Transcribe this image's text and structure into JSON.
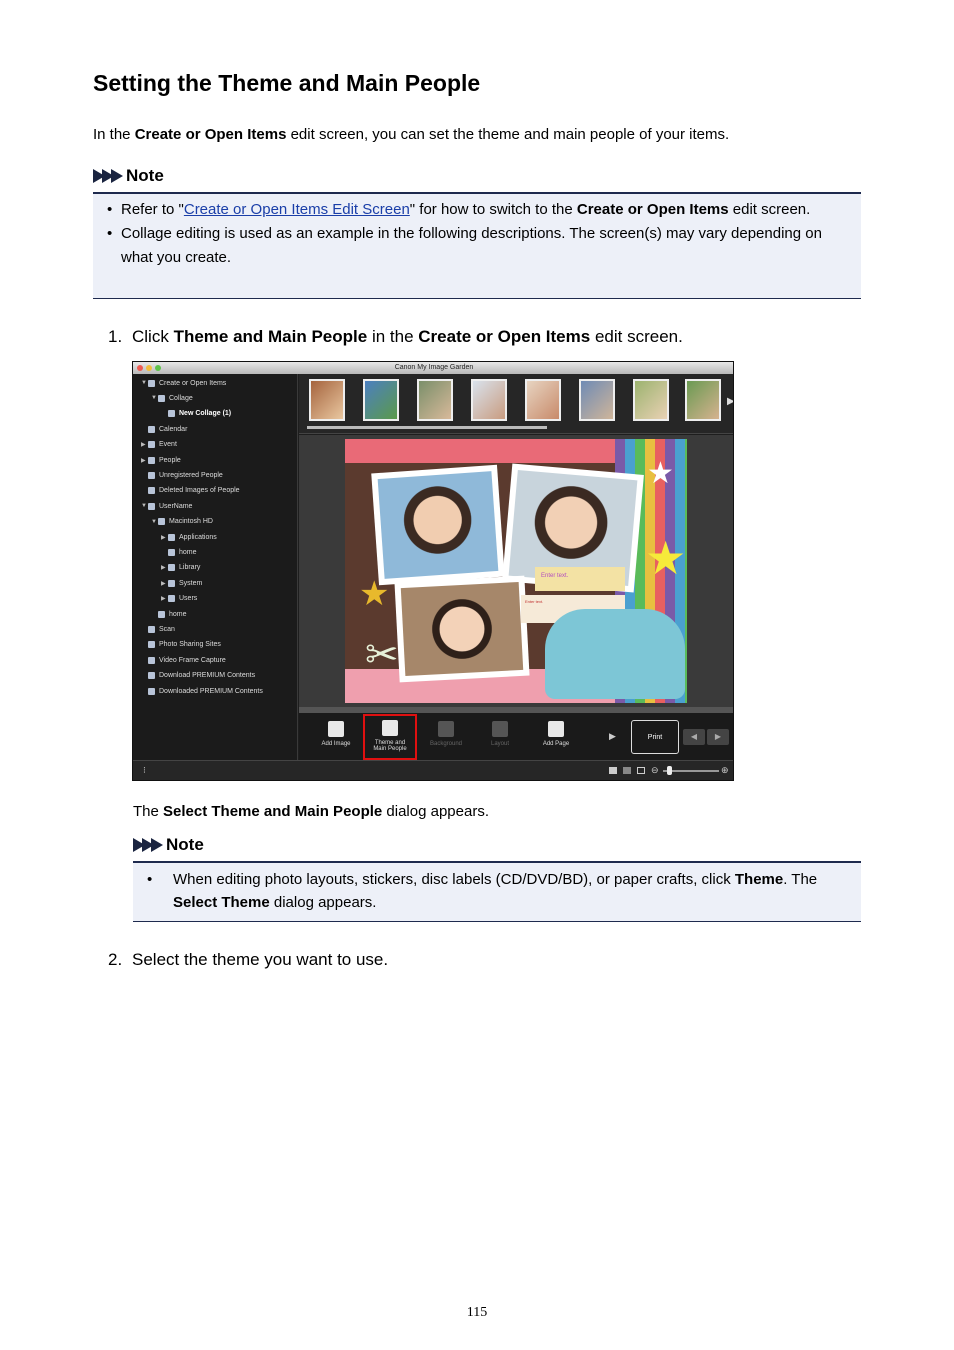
{
  "heading": "Setting the Theme and Main People",
  "intro": {
    "pre": "In the ",
    "bold": "Create or Open Items",
    "post": " edit screen, you can set the theme and main people of your items."
  },
  "note1": {
    "label": "Note",
    "item1": {
      "pre": "Refer to \"",
      "link": "Create or Open Items Edit Screen",
      "mid": "\" for how to switch to the ",
      "bold": "Create or Open Items",
      "post": " edit screen."
    },
    "item2": "Collage editing is used as an example in the following descriptions. The screen(s) may vary depending on what you create."
  },
  "step1": {
    "num": "1.",
    "pre": "Click ",
    "bold1": "Theme and Main People",
    "mid": " in the ",
    "bold2": "Create or Open Items",
    "post": " edit screen."
  },
  "screenshot": {
    "window_title": "Canon My Image Garden",
    "sidebar": [
      {
        "label": "Create or Open Items",
        "twisty": "▼"
      },
      {
        "label": "Collage",
        "twisty": "▼"
      },
      {
        "label": "New Collage (1)",
        "twisty": ""
      },
      {
        "label": "Calendar",
        "twisty": ""
      },
      {
        "label": "Event",
        "twisty": "▶"
      },
      {
        "label": "People",
        "twisty": "▶"
      },
      {
        "label": "Unregistered People",
        "twisty": ""
      },
      {
        "label": "Deleted Images of People",
        "twisty": ""
      },
      {
        "label": "UserName",
        "twisty": "▼"
      },
      {
        "label": "Macintosh HD",
        "twisty": "▼"
      },
      {
        "label": "Applications",
        "twisty": "▶"
      },
      {
        "label": "home",
        "twisty": ""
      },
      {
        "label": "Library",
        "twisty": "▶"
      },
      {
        "label": "System",
        "twisty": "▶"
      },
      {
        "label": "Users",
        "twisty": "▶"
      },
      {
        "label": "home",
        "twisty": ""
      },
      {
        "label": "Scan",
        "twisty": ""
      },
      {
        "label": "Photo Sharing Sites",
        "twisty": ""
      },
      {
        "label": "Video Frame Capture",
        "twisty": ""
      },
      {
        "label": "Download PREMIUM Contents",
        "twisty": ""
      },
      {
        "label": "Downloaded PREMIUM Contents",
        "twisty": ""
      }
    ],
    "canvas_text": {
      "enter_text": "Enter text.",
      "enter_text_small": "Enter text."
    },
    "toolbar": {
      "add_image": "Add Image",
      "theme_line1": "Theme and",
      "theme_line2": "Main People",
      "background": "Background",
      "layout": "Layout",
      "add_page": "Add Page",
      "print": "Print"
    },
    "colors": {
      "highlight": "#e01010"
    }
  },
  "caption": {
    "pre": "The ",
    "bold": "Select Theme and Main People",
    "post": " dialog appears."
  },
  "note2": {
    "label": "Note",
    "item": {
      "pre": "When editing photo layouts, stickers, disc labels (CD/DVD/BD), or paper crafts, click ",
      "bold1": "Theme",
      "mid": ". The ",
      "bold2": "Select Theme",
      "post": " dialog appears."
    }
  },
  "step2": {
    "num": "2.",
    "text": "Select the theme you want to use."
  },
  "page_number": "115"
}
